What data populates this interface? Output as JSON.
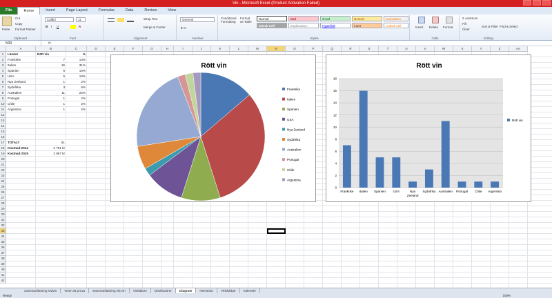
{
  "window": {
    "title": "Vin  -  Microsoft Excel (Product Activation Failed)"
  },
  "ribbon_tabs": [
    "File",
    "Home",
    "Insert",
    "Page Layout",
    "Formulas",
    "Data",
    "Review",
    "View"
  ],
  "ribbon": {
    "clipboard": {
      "paste": "Paste",
      "cut": "Cut",
      "copy": "Copy",
      "format_painter": "Format Painter",
      "label": "Clipboard"
    },
    "font": {
      "name": "Calibri",
      "size": "11",
      "label": "Font"
    },
    "alignment": {
      "wrap": "Wrap Text",
      "merge": "Merge & Center",
      "label": "Alignment"
    },
    "number": {
      "format": "General",
      "label": "Number"
    },
    "styles": {
      "cond": "Conditional Formatting",
      "table": "Format as Table",
      "boxes": [
        "Normal",
        "Bad",
        "Good",
        "Neutral",
        "Calculation",
        "Check Cell",
        "Explanatory...",
        "Hyperlink",
        "Input",
        "Linked Cell"
      ],
      "label": "Styles"
    },
    "cells": {
      "insert": "Insert",
      "delete": "Delete",
      "format": "Format",
      "label": "Cells"
    },
    "editing": {
      "autosum": "AutoSum",
      "fill": "Fill",
      "clear": "Clear",
      "sort": "Sort & Filter",
      "find": "Find & Select",
      "label": "Editing"
    }
  },
  "formula_bar": {
    "name_box": "N33",
    "fx": "fx",
    "content": ""
  },
  "columns": [
    "A",
    "B",
    "C",
    "D",
    "E",
    "F",
    "G",
    "H",
    "I",
    "J",
    "K",
    "L",
    "M",
    "N",
    "O",
    "P",
    "Q",
    "R",
    "S",
    "T",
    "U",
    "V",
    "W",
    "X",
    "Y",
    "Z",
    "AA"
  ],
  "rows": [
    "1",
    "2",
    "3",
    "4",
    "5",
    "6",
    "7",
    "8",
    "9",
    "10",
    "11",
    "12",
    "13",
    "14",
    "15",
    "16",
    "17",
    "18",
    "19",
    "20",
    "21",
    "22",
    "23",
    "24",
    "25",
    "26",
    "27",
    "28",
    "29",
    "30",
    "31",
    "32",
    "33",
    "34",
    "35",
    "36",
    "37",
    "38",
    "39",
    "40",
    "41",
    "42"
  ],
  "sheet": {
    "headers": {
      "a": "Länder",
      "b": "Rött vin",
      "c": "%"
    },
    "data": [
      {
        "land": "Frankrike",
        "antal": "7",
        "pct": "14%"
      },
      {
        "land": "Italien",
        "antal": "16",
        "pct": "31%"
      },
      {
        "land": "Spanien",
        "antal": "5",
        "pct": "10%"
      },
      {
        "land": "USA",
        "antal": "5",
        "pct": "10%"
      },
      {
        "land": "Nya Zeeland",
        "antal": "1",
        "pct": "2%"
      },
      {
        "land": "Sydafrika",
        "antal": "3",
        "pct": "6%"
      },
      {
        "land": "Australien",
        "antal": "11",
        "pct": "22%"
      },
      {
        "land": "Portugal",
        "antal": "1",
        "pct": "2%"
      },
      {
        "land": "Chile",
        "antal": "1",
        "pct": "2%"
      },
      {
        "land": "Argentina",
        "antal": "1",
        "pct": "2%"
      }
    ],
    "totals": [
      {
        "label": "TOTALT",
        "value": "51"
      },
      {
        "label": "Kostnad 2014",
        "value": "2 791 kr"
      },
      {
        "label": "Kostnad 2015",
        "value": "3 967 kr"
      }
    ]
  },
  "chart_data": [
    {
      "type": "pie",
      "title": "Rött vin",
      "categories": [
        "Frankrike",
        "Italien",
        "Spanien",
        "USA",
        "Nya Zeeland",
        "Sydafrika",
        "Australien",
        "Portugal",
        "Chile",
        "Argentina"
      ],
      "values": [
        7,
        16,
        5,
        5,
        1,
        3,
        11,
        1,
        1,
        1
      ],
      "colors": [
        "#4a78b5",
        "#b84a4a",
        "#8fad4f",
        "#6e5497",
        "#3d9bb0",
        "#e0883a",
        "#95a9d2",
        "#d59696",
        "#c2d59b",
        "#a79abf"
      ],
      "legend": "right"
    },
    {
      "type": "bar",
      "title": "Rött vin",
      "categories": [
        "Frankrike",
        "Italien",
        "Spanien",
        "USA",
        "Nya Zeeland",
        "Sydafrika",
        "Australien",
        "Portugal",
        "Chile",
        "Argentina"
      ],
      "series": [
        {
          "name": "Rött vin",
          "values": [
            7,
            16,
            5,
            5,
            1,
            3,
            11,
            1,
            1,
            1
          ],
          "color": "#4a78b5"
        }
      ],
      "ylim": [
        0,
        18
      ],
      "yticks": [
        "0",
        "2",
        "4",
        "6",
        "8",
        "10",
        "12",
        "14",
        "16",
        "18"
      ],
      "grid": true,
      "legend": "right"
    }
  ],
  "sheet_tabs": [
    "Sammanfattning rödvin",
    "Viner att prova",
    "Sammanfattning vitt vin",
    "Vinkällare",
    "Distributörer",
    "Diagram",
    "Hemsidor",
    "Vinklubbar",
    "Kalender"
  ],
  "active_sheet": "Diagram",
  "status": {
    "ready": "Ready",
    "zoom": "100%"
  }
}
